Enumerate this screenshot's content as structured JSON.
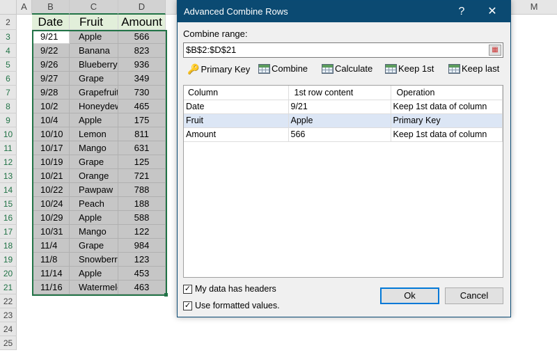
{
  "sheet": {
    "columns": [
      "A",
      "B",
      "C",
      "D",
      "M"
    ],
    "headers": [
      "Date",
      "Fruit",
      "Amount"
    ],
    "rows": [
      {
        "n": "3",
        "date": "9/21",
        "fruit": "Apple",
        "amount": "566"
      },
      {
        "n": "4",
        "date": "9/22",
        "fruit": "Banana",
        "amount": "823"
      },
      {
        "n": "5",
        "date": "9/26",
        "fruit": "Blueberry",
        "amount": "936"
      },
      {
        "n": "6",
        "date": "9/27",
        "fruit": "Grape",
        "amount": "349"
      },
      {
        "n": "7",
        "date": "9/28",
        "fruit": "Grapefruit",
        "amount": "730"
      },
      {
        "n": "8",
        "date": "10/2",
        "fruit": "Honeydew",
        "amount": "465"
      },
      {
        "n": "9",
        "date": "10/4",
        "fruit": "Apple",
        "amount": "175"
      },
      {
        "n": "10",
        "date": "10/10",
        "fruit": "Lemon",
        "amount": "811"
      },
      {
        "n": "11",
        "date": "10/17",
        "fruit": "Mango",
        "amount": "631"
      },
      {
        "n": "12",
        "date": "10/19",
        "fruit": "Grape",
        "amount": "125"
      },
      {
        "n": "13",
        "date": "10/21",
        "fruit": "Orange",
        "amount": "721"
      },
      {
        "n": "14",
        "date": "10/22",
        "fruit": "Pawpaw",
        "amount": "788"
      },
      {
        "n": "15",
        "date": "10/24",
        "fruit": "Peach",
        "amount": "188"
      },
      {
        "n": "16",
        "date": "10/29",
        "fruit": "Apple",
        "amount": "588"
      },
      {
        "n": "17",
        "date": "10/31",
        "fruit": "Mango",
        "amount": "122"
      },
      {
        "n": "18",
        "date": "11/4",
        "fruit": "Grape",
        "amount": "984"
      },
      {
        "n": "19",
        "date": "11/8",
        "fruit": "Snowberry",
        "amount": "123"
      },
      {
        "n": "20",
        "date": "11/14",
        "fruit": "Apple",
        "amount": "453"
      },
      {
        "n": "21",
        "date": "11/16",
        "fruit": "Watermelon",
        "amount": "463"
      }
    ],
    "header_row": "2",
    "empty_rows": [
      "22",
      "23",
      "24",
      "25"
    ]
  },
  "dialog": {
    "title": "Advanced Combine Rows",
    "help": "?",
    "close": "✕",
    "range_label": "Combine range:",
    "range_value": "$B$2:$D$21",
    "toolbar": [
      "Primary Key",
      "Combine",
      "Calculate",
      "Keep 1st",
      "Keep last"
    ],
    "table_headers": [
      "Column",
      "1st row content",
      "Operation"
    ],
    "table_rows": [
      [
        "Date",
        "9/21",
        "Keep 1st data of column"
      ],
      [
        "Fruit",
        "Apple",
        "Primary Key"
      ],
      [
        "Amount",
        "566",
        "Keep 1st data of column"
      ]
    ],
    "chk_headers": "My data has headers",
    "chk_formatted": "Use formatted values.",
    "ok": "Ok",
    "cancel": "Cancel"
  }
}
